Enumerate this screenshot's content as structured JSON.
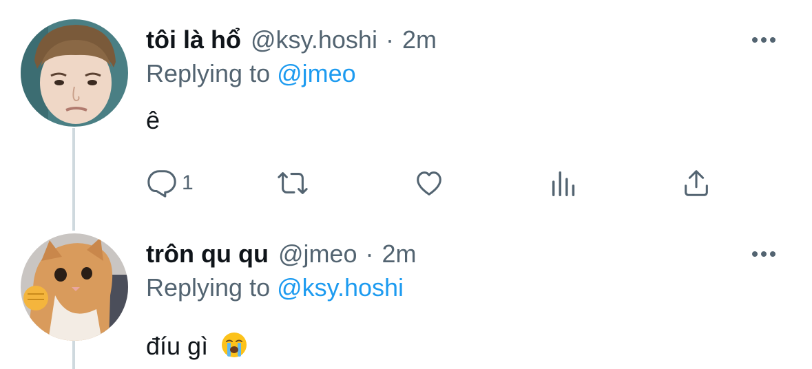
{
  "tweets": [
    {
      "display_name": "tôi là hổ",
      "handle": "@ksy.hoshi",
      "separator": "·",
      "time": "2m",
      "replying_prefix": "Replying to",
      "replying_to": "@jmeo",
      "text": "ê",
      "reply_count": "1",
      "avatar": "avatar-photo-person"
    },
    {
      "display_name": "trôn qu qu",
      "handle": "@jmeo",
      "separator": "·",
      "time": "2m",
      "replying_prefix": "Replying to",
      "replying_to": "@ksy.hoshi",
      "text": "đíu gì",
      "text_emoji": "loudly-crying-face-emoji",
      "avatar": "avatar-photo-cat"
    }
  ],
  "icons": {
    "more": "more-horizontal-icon",
    "reply": "reply-icon",
    "retweet": "retweet-icon",
    "like": "heart-icon",
    "views": "analytics-icon",
    "share": "share-icon"
  },
  "colors": {
    "text_primary": "#0f1419",
    "text_secondary": "#536471",
    "accent_link": "#1d9bf0",
    "thread_line": "#cfd9de"
  }
}
